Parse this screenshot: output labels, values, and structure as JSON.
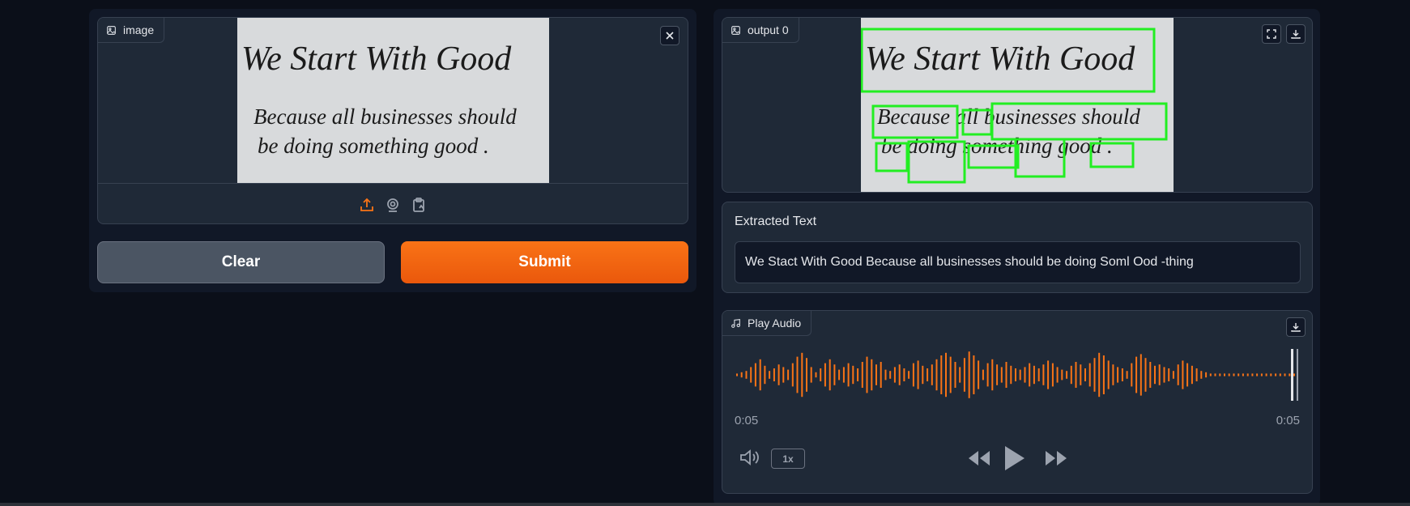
{
  "input": {
    "label": "image",
    "photo_line1": "We Start With Good",
    "photo_line2": "Because all businesses should",
    "photo_line3": "be doing something good ."
  },
  "buttons": {
    "clear": "Clear",
    "submit": "Submit"
  },
  "output": {
    "label": "output 0",
    "photo_line1": "We Start With Good",
    "photo_line2": "Because all businesses should",
    "photo_line3": "be doing something good ."
  },
  "extracted": {
    "label": "Extracted Text",
    "value": "We Stact With Good Because all businesses should be doing Soml Ood -thing"
  },
  "audio": {
    "label": "Play Audio",
    "time_current": "0:05",
    "time_total": "0:05",
    "speed": "1x",
    "waveform_color": "#f97316"
  },
  "colors": {
    "accent": "#f97316",
    "bbox": "#22ee22"
  },
  "icons": [
    "image-icon",
    "close-icon",
    "upload-icon",
    "webcam-icon",
    "clipboard-icon",
    "fullscreen-icon",
    "download-icon",
    "music-icon",
    "volume-icon",
    "rewind-icon",
    "play-icon",
    "fast-forward-icon"
  ]
}
